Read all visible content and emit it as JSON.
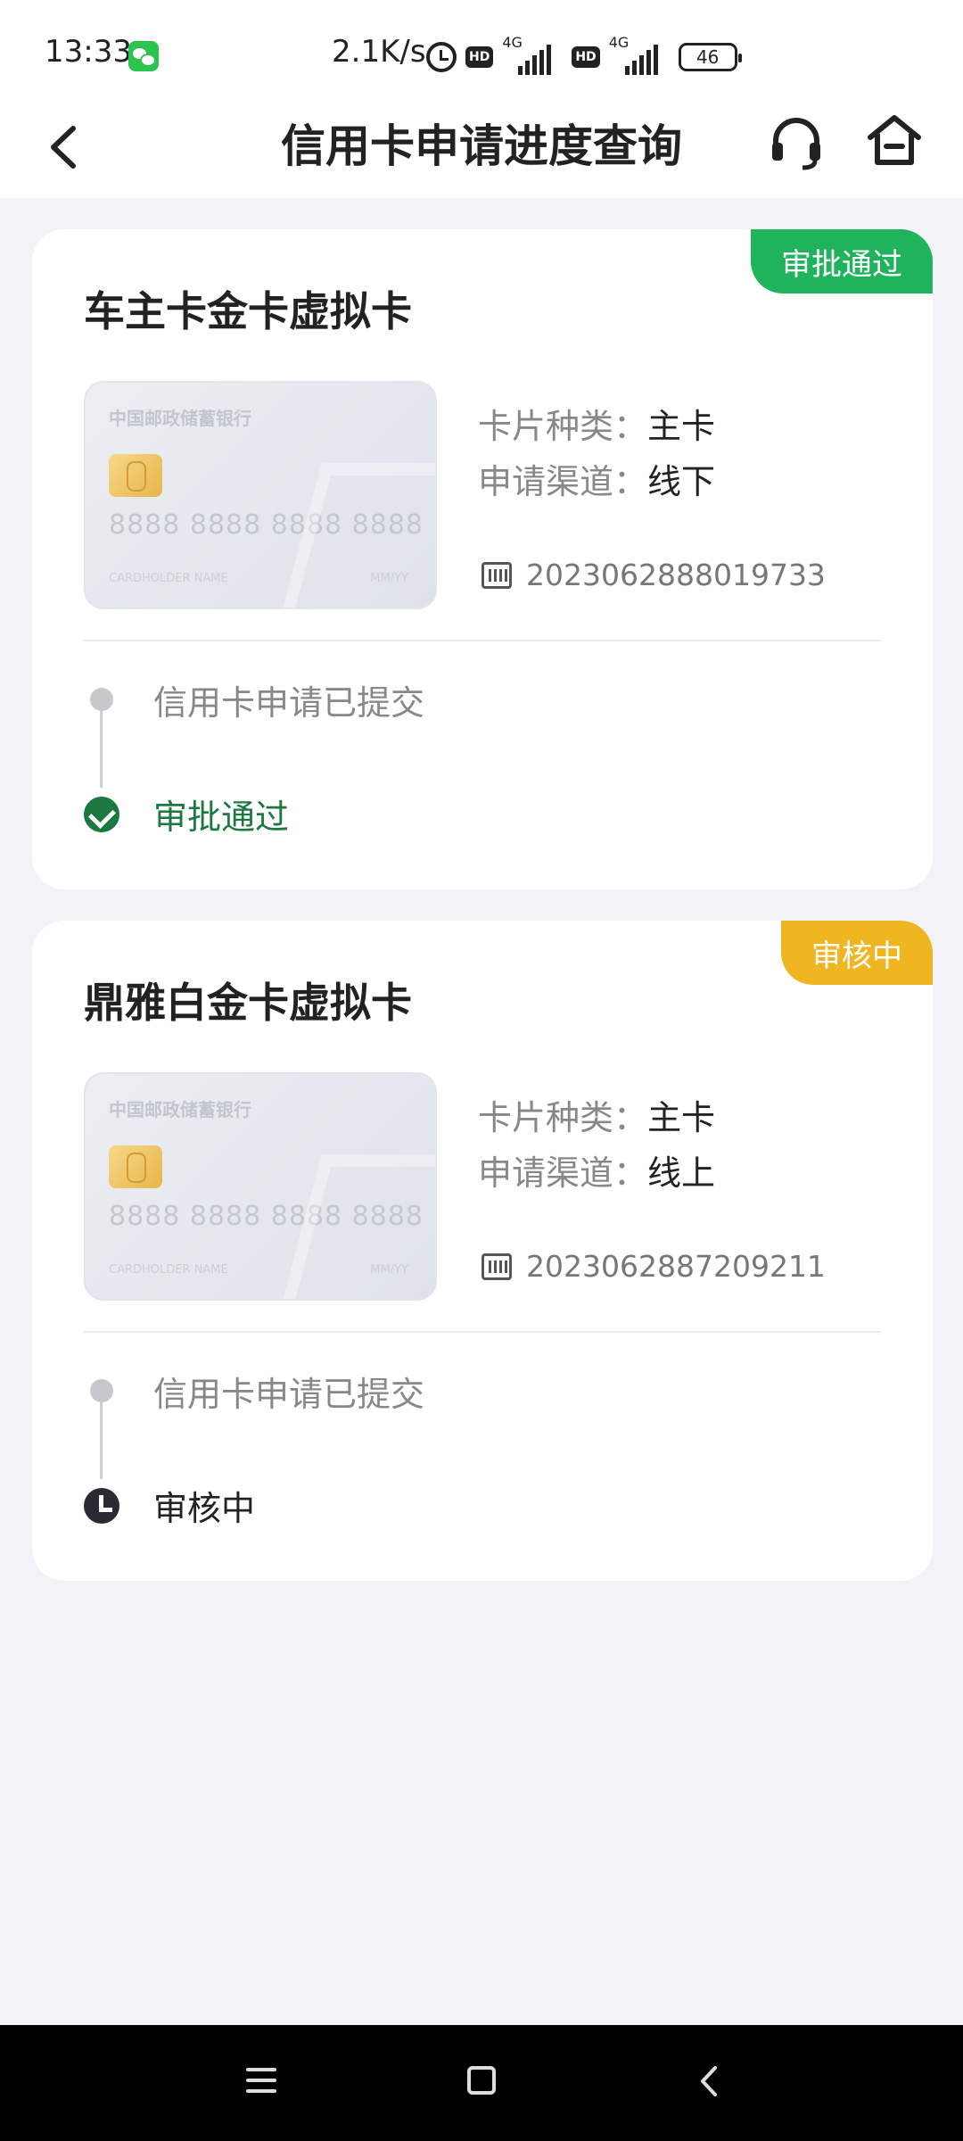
{
  "status_bar": {
    "time": "13:33",
    "speed": "2.1K/s",
    "hd1": "HD",
    "hd2": "HD",
    "net1": "4G",
    "net2": "4G",
    "battery": "46"
  },
  "header": {
    "title": "信用卡申请进度查询",
    "back_icon": "chevron-left-icon",
    "service_icon": "headset-icon",
    "home_icon": "home-icon"
  },
  "card_image": {
    "bank": "中国邮政储蓄银行",
    "number": "8888 8888 8888 8888",
    "holder": "CARDHOLDER NAME",
    "expiry": "MM/YY"
  },
  "labels": {
    "card_type": "卡片种类：",
    "channel": "申请渠道："
  },
  "applications": [
    {
      "status": "审批通过",
      "status_color": "#1fb35c",
      "title": "车主卡金卡虚拟卡",
      "card_type": "主卡",
      "channel": "线下",
      "app_no": "2023062888019733",
      "steps": [
        "信用卡申请已提交",
        "审批通过"
      ]
    },
    {
      "status": "审核中",
      "status_color": "#f0b622",
      "title": "鼎雅白金卡虚拟卡",
      "card_type": "主卡",
      "channel": "线上",
      "app_no": "2023062887209211",
      "steps": [
        "信用卡申请已提交",
        "审核中"
      ]
    }
  ],
  "colors": {
    "approved_text": "#1a7840",
    "background": "#f3f3f7"
  }
}
